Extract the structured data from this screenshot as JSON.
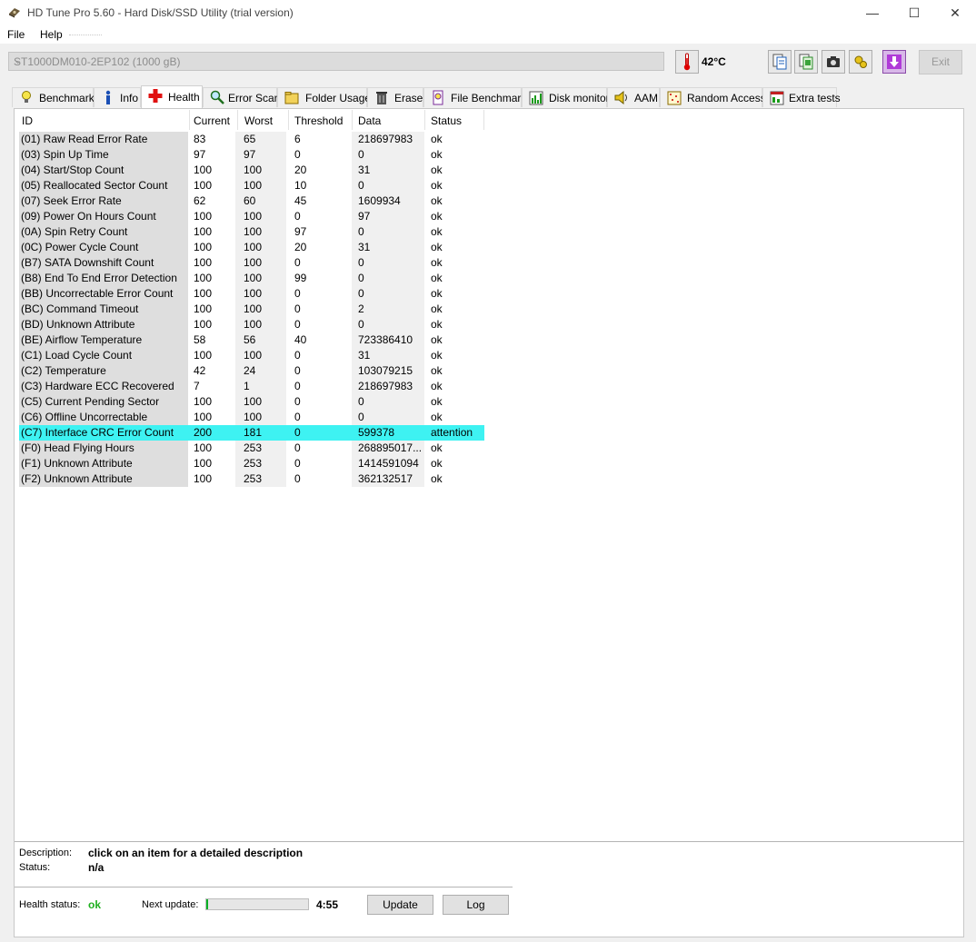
{
  "window": {
    "title": "HD Tune Pro 5.60 - Hard Disk/SSD Utility (trial version)",
    "controls": [
      "—",
      "☐",
      "✕"
    ]
  },
  "menu": {
    "file": "File",
    "help": "Help"
  },
  "toolbar": {
    "drive": "ST1000DM010-2EP102 (1000 gB)",
    "temperature": "42°C",
    "exit_label": "Exit",
    "icons": [
      "copy-icon",
      "copy-screen-icon",
      "camera-icon",
      "options-icon",
      "save-icon"
    ]
  },
  "tabs": [
    {
      "label": "Benchmark",
      "icon": "benchmark-icon"
    },
    {
      "label": "Info",
      "icon": "info-icon"
    },
    {
      "label": "Health",
      "icon": "health-cross-icon"
    },
    {
      "label": "Error Scan",
      "icon": "magnifier-icon"
    },
    {
      "label": "Folder Usage",
      "icon": "folder-icon"
    },
    {
      "label": "Erase",
      "icon": "trash-icon"
    },
    {
      "label": "File Benchmark",
      "icon": "file-benchmark-icon"
    },
    {
      "label": "Disk monitor",
      "icon": "disk-monitor-icon"
    },
    {
      "label": "AAM",
      "icon": "speaker-icon"
    },
    {
      "label": "Random Access",
      "icon": "random-access-icon"
    },
    {
      "label": "Extra tests",
      "icon": "extra-tests-icon"
    }
  ],
  "table": {
    "headers": [
      "ID",
      "Current",
      "Worst",
      "Threshold",
      "Data",
      "Status"
    ],
    "rows": [
      [
        "(01) Raw Read Error Rate",
        "83",
        "65",
        "6",
        "218697983",
        "ok"
      ],
      [
        "(03) Spin Up Time",
        "97",
        "97",
        "0",
        "0",
        "ok"
      ],
      [
        "(04) Start/Stop Count",
        "100",
        "100",
        "20",
        "31",
        "ok"
      ],
      [
        "(05) Reallocated Sector Count",
        "100",
        "100",
        "10",
        "0",
        "ok"
      ],
      [
        "(07) Seek Error Rate",
        "62",
        "60",
        "45",
        "1609934",
        "ok"
      ],
      [
        "(09) Power On Hours Count",
        "100",
        "100",
        "0",
        "97",
        "ok"
      ],
      [
        "(0A) Spin Retry Count",
        "100",
        "100",
        "97",
        "0",
        "ok"
      ],
      [
        "(0C) Power Cycle Count",
        "100",
        "100",
        "20",
        "31",
        "ok"
      ],
      [
        "(B7) SATA Downshift Count",
        "100",
        "100",
        "0",
        "0",
        "ok"
      ],
      [
        "(B8) End To End Error Detection",
        "100",
        "100",
        "99",
        "0",
        "ok"
      ],
      [
        "(BB) Uncorrectable Error Count",
        "100",
        "100",
        "0",
        "0",
        "ok"
      ],
      [
        "(BC) Command Timeout",
        "100",
        "100",
        "0",
        "2",
        "ok"
      ],
      [
        "(BD) Unknown Attribute",
        "100",
        "100",
        "0",
        "0",
        "ok"
      ],
      [
        "(BE) Airflow Temperature",
        "58",
        "56",
        "40",
        "723386410",
        "ok"
      ],
      [
        "(C1) Load Cycle Count",
        "100",
        "100",
        "0",
        "31",
        "ok"
      ],
      [
        "(C2) Temperature",
        "42",
        "24",
        "0",
        "103079215",
        "ok"
      ],
      [
        "(C3) Hardware ECC Recovered",
        "7",
        "1",
        "0",
        "218697983",
        "ok"
      ],
      [
        "(C5) Current Pending Sector",
        "100",
        "100",
        "0",
        "0",
        "ok"
      ],
      [
        "(C6) Offline Uncorrectable",
        "100",
        "100",
        "0",
        "0",
        "ok"
      ],
      [
        "(C7) Interface CRC Error Count",
        "200",
        "181",
        "0",
        "599378",
        "attention"
      ],
      [
        "(F0) Head Flying Hours",
        "100",
        "253",
        "0",
        "268895017...",
        "ok"
      ],
      [
        "(F1) Unknown Attribute",
        "100",
        "253",
        "0",
        "1414591094",
        "ok"
      ],
      [
        "(F2) Unknown Attribute",
        "100",
        "253",
        "0",
        "362132517",
        "ok"
      ]
    ],
    "highlight_color": "#3ef2f2"
  },
  "bottom": {
    "description_label": "Description:",
    "description_value": "click on an item for a detailed description",
    "status_label": "Status:",
    "status_value": "n/a",
    "health_label": "Health status:",
    "health_value": "ok",
    "health_color": "#1fb01f",
    "next_update_label": "Next update:",
    "next_update_progress": 0.01,
    "countdown": "4:55",
    "update_label": "Update",
    "log_label": "Log"
  }
}
